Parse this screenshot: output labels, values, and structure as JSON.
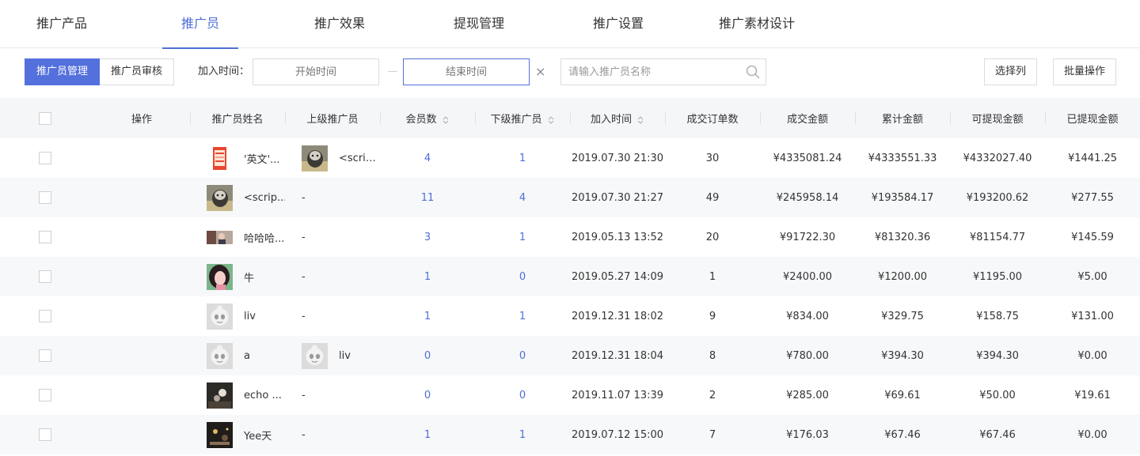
{
  "tabs": [
    "推广产品",
    "推广员",
    "推广效果",
    "提现管理",
    "推广设置",
    "推广素材设计"
  ],
  "active_tab": 1,
  "toolbar": {
    "seg": [
      "推广员管理",
      "推广员审核"
    ],
    "join_label": "加入时间：",
    "start_placeholder": "开始时间",
    "end_placeholder": "结束时间",
    "clear_symbol": "×",
    "range_sep": "—",
    "search_placeholder": "请输入推广员名称",
    "select_columns": "选择列",
    "batch_ops": "批量操作"
  },
  "colors": {
    "accent": "#5470dc",
    "link": "#4f6ed6",
    "header_bg": "#f5f6f8",
    "zebra": "#f7f8fa"
  },
  "columns": [
    "操作",
    "推广员姓名",
    "上级推广员",
    "会员数",
    "下级推广员",
    "加入时间",
    "成交订单数",
    "成交金额",
    "累计金额",
    "可提现金额",
    "已提现金额"
  ],
  "rows": [
    {
      "avatar": "phone-screenshot-avatar",
      "name": "'英文'...",
      "parent_avatar": "cat-photo-avatar",
      "parent": "<scrip...",
      "members": "4",
      "sub": "1",
      "time": "2019.07.30 21:30",
      "orders": "30",
      "deal": "¥4335081.24",
      "total": "¥4333551.33",
      "withdrawable": "¥4332027.40",
      "withdrawn": "¥1441.25"
    },
    {
      "avatar": "cat-photo-avatar",
      "name": "<scrip...",
      "parent": "-",
      "members": "11",
      "sub": "4",
      "time": "2019.07.30 21:27",
      "orders": "49",
      "deal": "¥245958.14",
      "total": "¥193584.17",
      "withdrawable": "¥193200.62",
      "withdrawn": "¥277.55"
    },
    {
      "avatar": "person-photo-avatar",
      "name": "哈哈哈...",
      "parent": "-",
      "members": "3",
      "sub": "1",
      "time": "2019.05.13 13:52",
      "orders": "20",
      "deal": "¥91722.30",
      "total": "¥81320.36",
      "withdrawable": "¥81154.77",
      "withdrawn": "¥145.59"
    },
    {
      "avatar": "girl-photo-avatar",
      "name": "牛",
      "parent": "-",
      "members": "1",
      "sub": "0",
      "time": "2019.05.27 14:09",
      "orders": "1",
      "deal": "¥2400.00",
      "total": "¥1200.00",
      "withdrawable": "¥1195.00",
      "withdrawn": "¥5.00"
    },
    {
      "avatar": "default-panda-avatar",
      "name": "liv",
      "parent": "-",
      "members": "1",
      "sub": "1",
      "time": "2019.12.31 18:02",
      "orders": "9",
      "deal": "¥834.00",
      "total": "¥329.75",
      "withdrawable": "¥158.75",
      "withdrawn": "¥131.00"
    },
    {
      "avatar": "default-panda-avatar",
      "name": "a",
      "parent_avatar": "default-panda-avatar",
      "parent": "liv",
      "members": "0",
      "sub": "0",
      "time": "2019.12.31 18:04",
      "orders": "8",
      "deal": "¥780.00",
      "total": "¥394.30",
      "withdrawable": "¥394.30",
      "withdrawn": "¥0.00"
    },
    {
      "avatar": "flower-photo-avatar",
      "name": "echo ...",
      "parent": "-",
      "members": "0",
      "sub": "0",
      "time": "2019.11.07 13:39",
      "orders": "2",
      "deal": "¥285.00",
      "total": "¥69.61",
      "withdrawable": "¥50.00",
      "withdrawn": "¥19.61"
    },
    {
      "avatar": "night-photo-avatar",
      "name": "Yee天",
      "parent": "-",
      "members": "1",
      "sub": "1",
      "time": "2019.07.12 15:00",
      "orders": "7",
      "deal": "¥176.03",
      "total": "¥67.46",
      "withdrawable": "¥67.46",
      "withdrawn": "¥0.00"
    }
  ]
}
